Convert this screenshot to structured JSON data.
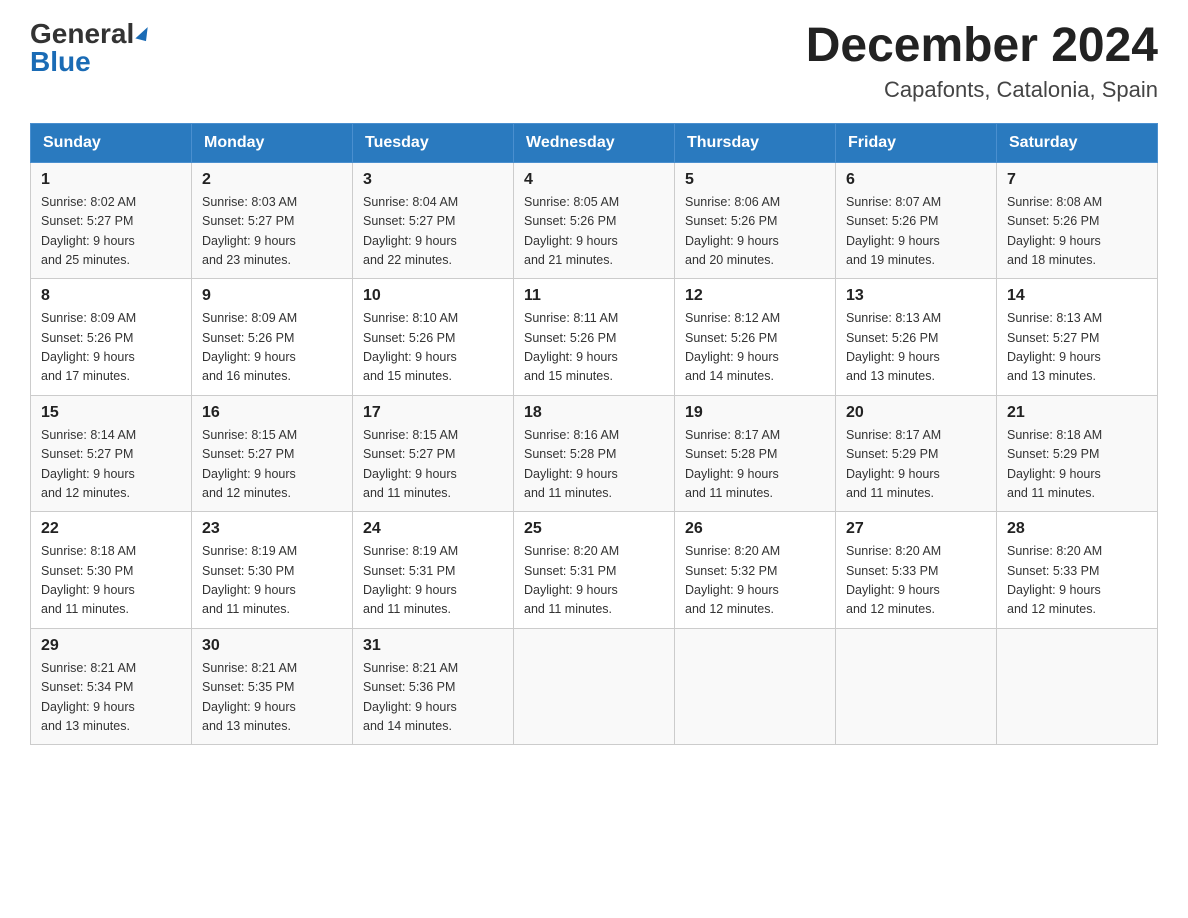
{
  "header": {
    "logo_general": "General",
    "logo_blue": "Blue",
    "month_title": "December 2024",
    "location": "Capafonts, Catalonia, Spain"
  },
  "weekdays": [
    "Sunday",
    "Monday",
    "Tuesday",
    "Wednesday",
    "Thursday",
    "Friday",
    "Saturday"
  ],
  "weeks": [
    [
      {
        "day": "1",
        "sunrise": "8:02 AM",
        "sunset": "5:27 PM",
        "daylight": "9 hours and 25 minutes."
      },
      {
        "day": "2",
        "sunrise": "8:03 AM",
        "sunset": "5:27 PM",
        "daylight": "9 hours and 23 minutes."
      },
      {
        "day": "3",
        "sunrise": "8:04 AM",
        "sunset": "5:27 PM",
        "daylight": "9 hours and 22 minutes."
      },
      {
        "day": "4",
        "sunrise": "8:05 AM",
        "sunset": "5:26 PM",
        "daylight": "9 hours and 21 minutes."
      },
      {
        "day": "5",
        "sunrise": "8:06 AM",
        "sunset": "5:26 PM",
        "daylight": "9 hours and 20 minutes."
      },
      {
        "day": "6",
        "sunrise": "8:07 AM",
        "sunset": "5:26 PM",
        "daylight": "9 hours and 19 minutes."
      },
      {
        "day": "7",
        "sunrise": "8:08 AM",
        "sunset": "5:26 PM",
        "daylight": "9 hours and 18 minutes."
      }
    ],
    [
      {
        "day": "8",
        "sunrise": "8:09 AM",
        "sunset": "5:26 PM",
        "daylight": "9 hours and 17 minutes."
      },
      {
        "day": "9",
        "sunrise": "8:09 AM",
        "sunset": "5:26 PM",
        "daylight": "9 hours and 16 minutes."
      },
      {
        "day": "10",
        "sunrise": "8:10 AM",
        "sunset": "5:26 PM",
        "daylight": "9 hours and 15 minutes."
      },
      {
        "day": "11",
        "sunrise": "8:11 AM",
        "sunset": "5:26 PM",
        "daylight": "9 hours and 15 minutes."
      },
      {
        "day": "12",
        "sunrise": "8:12 AM",
        "sunset": "5:26 PM",
        "daylight": "9 hours and 14 minutes."
      },
      {
        "day": "13",
        "sunrise": "8:13 AM",
        "sunset": "5:26 PM",
        "daylight": "9 hours and 13 minutes."
      },
      {
        "day": "14",
        "sunrise": "8:13 AM",
        "sunset": "5:27 PM",
        "daylight": "9 hours and 13 minutes."
      }
    ],
    [
      {
        "day": "15",
        "sunrise": "8:14 AM",
        "sunset": "5:27 PM",
        "daylight": "9 hours and 12 minutes."
      },
      {
        "day": "16",
        "sunrise": "8:15 AM",
        "sunset": "5:27 PM",
        "daylight": "9 hours and 12 minutes."
      },
      {
        "day": "17",
        "sunrise": "8:15 AM",
        "sunset": "5:27 PM",
        "daylight": "9 hours and 11 minutes."
      },
      {
        "day": "18",
        "sunrise": "8:16 AM",
        "sunset": "5:28 PM",
        "daylight": "9 hours and 11 minutes."
      },
      {
        "day": "19",
        "sunrise": "8:17 AM",
        "sunset": "5:28 PM",
        "daylight": "9 hours and 11 minutes."
      },
      {
        "day": "20",
        "sunrise": "8:17 AM",
        "sunset": "5:29 PM",
        "daylight": "9 hours and 11 minutes."
      },
      {
        "day": "21",
        "sunrise": "8:18 AM",
        "sunset": "5:29 PM",
        "daylight": "9 hours and 11 minutes."
      }
    ],
    [
      {
        "day": "22",
        "sunrise": "8:18 AM",
        "sunset": "5:30 PM",
        "daylight": "9 hours and 11 minutes."
      },
      {
        "day": "23",
        "sunrise": "8:19 AM",
        "sunset": "5:30 PM",
        "daylight": "9 hours and 11 minutes."
      },
      {
        "day": "24",
        "sunrise": "8:19 AM",
        "sunset": "5:31 PM",
        "daylight": "9 hours and 11 minutes."
      },
      {
        "day": "25",
        "sunrise": "8:20 AM",
        "sunset": "5:31 PM",
        "daylight": "9 hours and 11 minutes."
      },
      {
        "day": "26",
        "sunrise": "8:20 AM",
        "sunset": "5:32 PM",
        "daylight": "9 hours and 12 minutes."
      },
      {
        "day": "27",
        "sunrise": "8:20 AM",
        "sunset": "5:33 PM",
        "daylight": "9 hours and 12 minutes."
      },
      {
        "day": "28",
        "sunrise": "8:20 AM",
        "sunset": "5:33 PM",
        "daylight": "9 hours and 12 minutes."
      }
    ],
    [
      {
        "day": "29",
        "sunrise": "8:21 AM",
        "sunset": "5:34 PM",
        "daylight": "9 hours and 13 minutes."
      },
      {
        "day": "30",
        "sunrise": "8:21 AM",
        "sunset": "5:35 PM",
        "daylight": "9 hours and 13 minutes."
      },
      {
        "day": "31",
        "sunrise": "8:21 AM",
        "sunset": "5:36 PM",
        "daylight": "9 hours and 14 minutes."
      },
      null,
      null,
      null,
      null
    ]
  ]
}
